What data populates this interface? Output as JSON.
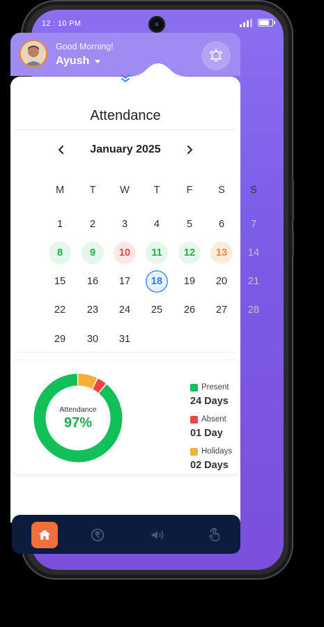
{
  "status_bar": {
    "time": "12 : 10 PM"
  },
  "header": {
    "greeting": "Good Morning!",
    "user_name": "Ayush"
  },
  "page_title": "Attendance",
  "calendar": {
    "month_label": "January 2025",
    "weekdays": [
      "M",
      "T",
      "W",
      "T",
      "F",
      "S",
      "S"
    ],
    "rows": [
      [
        {
          "d": "1"
        },
        {
          "d": "2"
        },
        {
          "d": "3"
        },
        {
          "d": "4"
        },
        {
          "d": "5"
        },
        {
          "d": "6"
        },
        {
          "d": "7",
          "s": "muted"
        }
      ],
      [
        {
          "d": "8",
          "s": "present"
        },
        {
          "d": "9",
          "s": "present"
        },
        {
          "d": "10",
          "s": "absent"
        },
        {
          "d": "11",
          "s": "present"
        },
        {
          "d": "12",
          "s": "present"
        },
        {
          "d": "13",
          "s": "holiday"
        },
        {
          "d": "14",
          "s": "muted"
        }
      ],
      [
        {
          "d": "15"
        },
        {
          "d": "16"
        },
        {
          "d": "17"
        },
        {
          "d": "18",
          "s": "today"
        },
        {
          "d": "19"
        },
        {
          "d": "20"
        },
        {
          "d": "21",
          "s": "muted"
        }
      ],
      [
        {
          "d": "22"
        },
        {
          "d": "23"
        },
        {
          "d": "24"
        },
        {
          "d": "25"
        },
        {
          "d": "26"
        },
        {
          "d": "27"
        },
        {
          "d": "28",
          "s": "muted"
        }
      ],
      [
        {
          "d": "29"
        },
        {
          "d": "30"
        },
        {
          "d": "31"
        }
      ]
    ]
  },
  "summary": {
    "center_label": "Attendance",
    "center_value": "97%",
    "legend": [
      {
        "label": "Present",
        "value": "24 Days",
        "color": "#12c05a"
      },
      {
        "label": "Absent",
        "value": "01 Day",
        "color": "#ef4444"
      },
      {
        "label": "Holidays",
        "value": "02 Days",
        "color": "#f6b03a"
      }
    ]
  },
  "chart_data": {
    "type": "pie",
    "categories": [
      "Present",
      "Absent",
      "Holidays"
    ],
    "values": [
      24,
      1,
      2
    ],
    "colors": [
      "#12c05a",
      "#ef4444",
      "#f6b03a"
    ]
  },
  "bottom_nav": {
    "items": [
      {
        "icon": "home-icon",
        "active": true
      },
      {
        "icon": "rupee-icon",
        "active": false
      },
      {
        "icon": "megaphone-icon",
        "active": false
      },
      {
        "icon": "touch-icon",
        "active": false
      }
    ]
  }
}
